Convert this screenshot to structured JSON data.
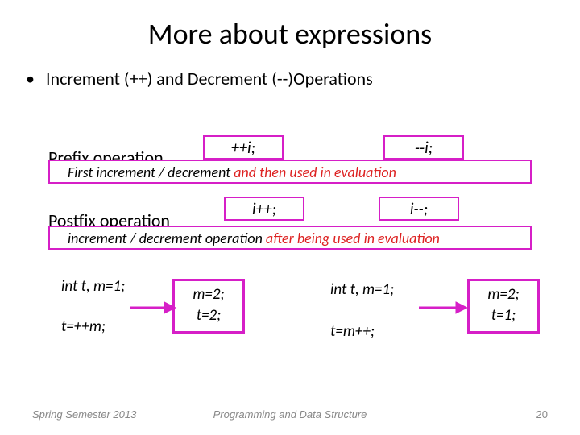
{
  "title": "More about expressions",
  "bullet": "Increment (++) and Decrement (--)Operations",
  "prefix": {
    "label": "Prefix operation",
    "ex1": "++i;",
    "ex2": "--i;",
    "explain_pre": "First increment / decrement ",
    "explain_red": "and then used in evaluation"
  },
  "postfix": {
    "label": "Postfix operation",
    "ex1": "i++;",
    "ex2": "i--;",
    "explain_pre": "increment / decrement operation ",
    "explain_red": "after being  used in evaluation"
  },
  "example_left": {
    "decl": "int t, m=1;",
    "stmt": "t=++m;",
    "result_m": "m=2;",
    "result_t": "t=2;"
  },
  "example_right": {
    "decl": "int t, m=1;",
    "stmt": "t=m++;",
    "result_m": "m=2;",
    "result_t": "t=1;"
  },
  "footer": {
    "left": "Spring Semester 2013",
    "center": "Programming and Data Structure",
    "right": "20"
  }
}
